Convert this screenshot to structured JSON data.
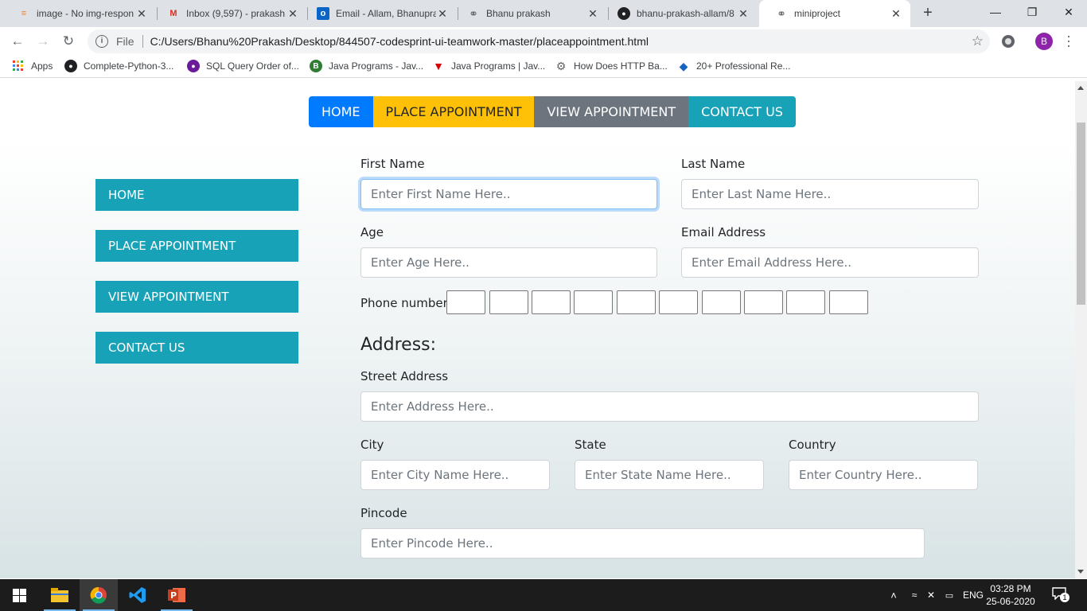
{
  "browser": {
    "tabs": [
      {
        "title": "image - No img-respon",
        "icon": "stackoverflow-icon"
      },
      {
        "title": "Inbox (9,597) - prakash",
        "icon": "gmail-icon"
      },
      {
        "title": "Email - Allam, Bhanupra",
        "icon": "outlook-icon"
      },
      {
        "title": "Bhanu prakash",
        "icon": "globe-icon"
      },
      {
        "title": "bhanu-prakash-allam/8",
        "icon": "github-icon"
      },
      {
        "title": "miniproject",
        "icon": "globe-icon",
        "active": true
      }
    ],
    "address_scheme": "File",
    "address_url": "C:/Users/Bhanu%20Prakash/Desktop/844507-codesprint-ui-teamwork-master/placeappointment.html",
    "profile_initial": "B",
    "bookmarks": [
      "Apps",
      "Complete-Python-3...",
      "SQL Query Order of...",
      "Java Programs - Jav...",
      "Java Programs | Jav...",
      "How Does HTTP Ba...",
      "20+ Professional Re..."
    ]
  },
  "page": {
    "top_nav": [
      "HOME",
      "PLACE APPOINTMENT",
      "VIEW APPOINTMENT",
      "CONTACT US"
    ],
    "side_nav": [
      "HOME",
      "PLACE APPOINTMENT",
      "VIEW APPOINTMENT",
      "CONTACT US"
    ],
    "form": {
      "first_name_label": "First Name",
      "first_name_placeholder": "Enter First Name Here..",
      "last_name_label": "Last Name",
      "last_name_placeholder": "Enter Last Name Here..",
      "age_label": "Age",
      "age_placeholder": "Enter Age Here..",
      "email_label": "Email Address",
      "email_placeholder": "Enter Email Address Here..",
      "phone_label": "Phone number",
      "address_heading": "Address:",
      "street_label": "Street Address",
      "street_placeholder": "Enter Address Here..",
      "city_label": "City",
      "city_placeholder": "Enter City Name Here..",
      "state_label": "State",
      "state_placeholder": "Enter State Name Here..",
      "country_label": "Country",
      "country_placeholder": "Enter Country Here..",
      "pincode_label": "Pincode",
      "pincode_placeholder": "Enter Pincode Here.."
    },
    "colors": {
      "primary": "#007bff",
      "warning": "#ffc107",
      "secondary": "#6c757d",
      "info": "#17a2b8"
    }
  },
  "taskbar": {
    "time": "03:28 PM",
    "date": "25-06-2020",
    "language": "ENG",
    "notification_count": "1"
  }
}
